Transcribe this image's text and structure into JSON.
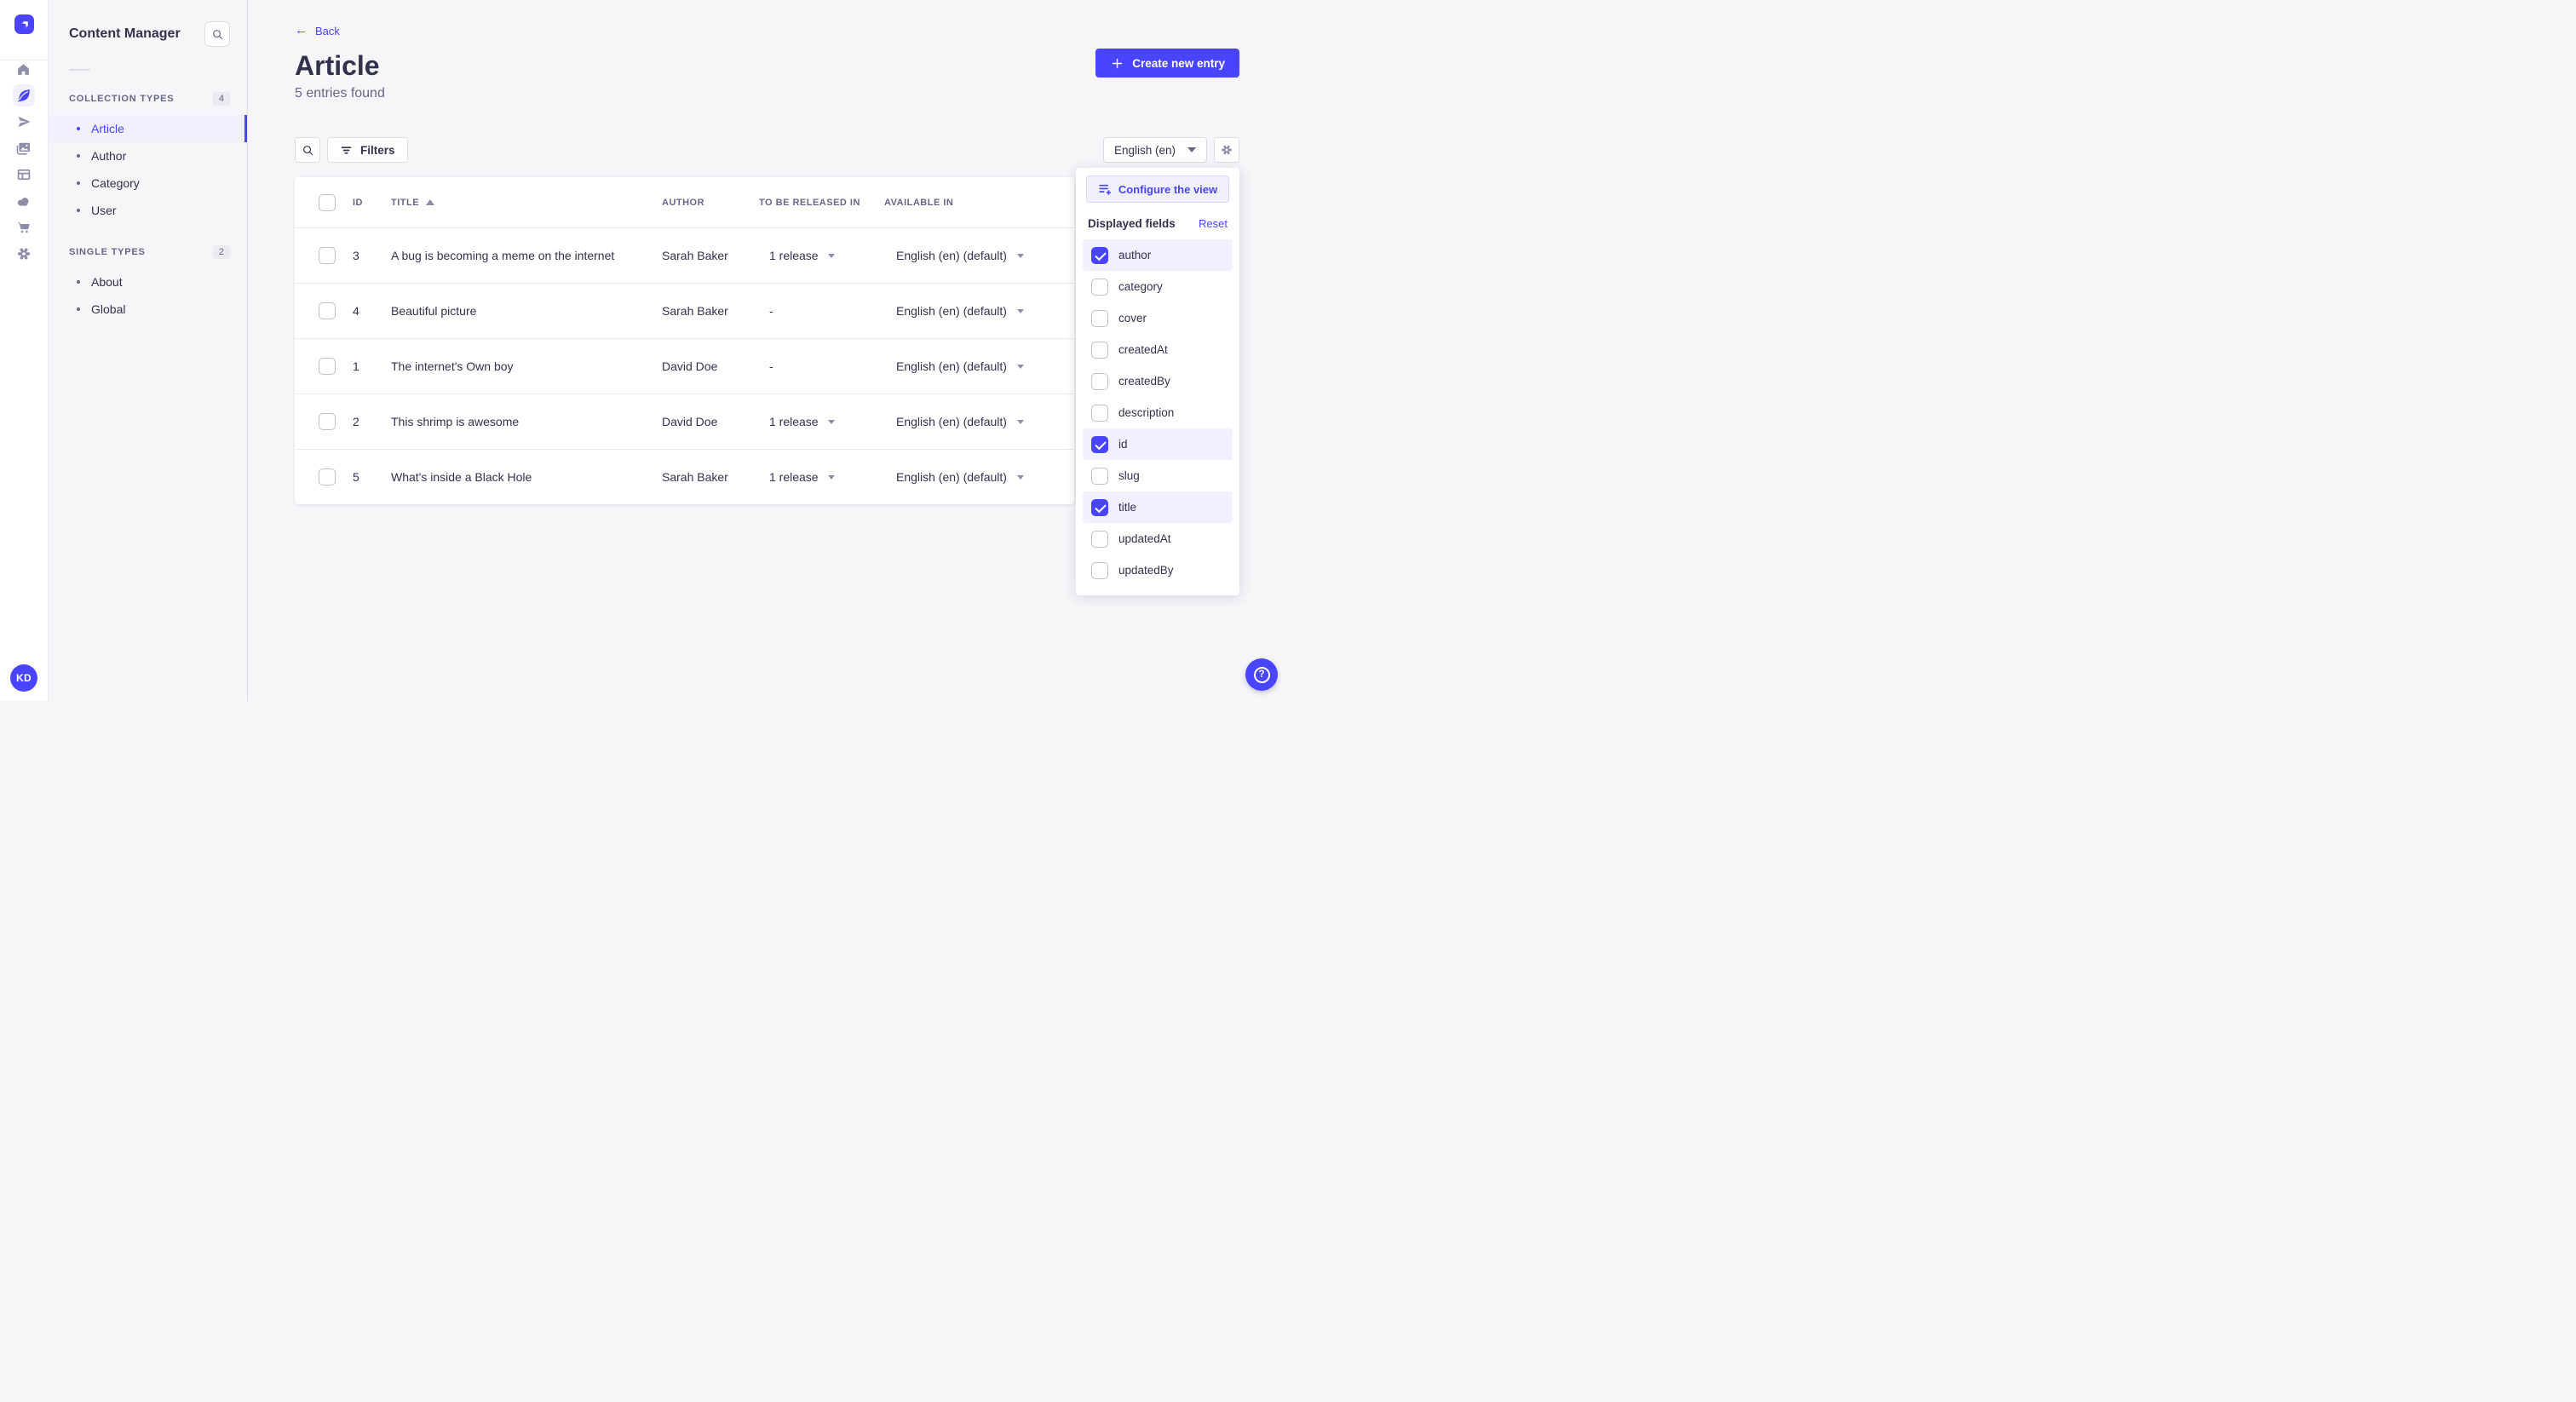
{
  "colors": {
    "primary": "#4945ff",
    "primary_light": "#f0f0ff",
    "text": "#32324d",
    "text_muted": "#666687"
  },
  "icons": {
    "back_arrow": "←",
    "help": "?"
  },
  "nav_rail": {
    "avatar_initials": "KD"
  },
  "subnav": {
    "title": "Content Manager",
    "sections": [
      {
        "label": "COLLECTION TYPES",
        "count": "4",
        "items": [
          {
            "label": "Article",
            "active": true
          },
          {
            "label": "Author",
            "active": false
          },
          {
            "label": "Category",
            "active": false
          },
          {
            "label": "User",
            "active": false
          }
        ]
      },
      {
        "label": "SINGLE TYPES",
        "count": "2",
        "items": [
          {
            "label": "About",
            "active": false
          },
          {
            "label": "Global",
            "active": false
          }
        ]
      }
    ]
  },
  "header": {
    "back_label": "Back",
    "title": "Article",
    "subtitle": "5 entries found",
    "create_button_label": "Create new entry"
  },
  "toolbar": {
    "filters_label": "Filters",
    "locale_value": "English (en)"
  },
  "table": {
    "columns": [
      "ID",
      "TITLE",
      "AUTHOR",
      "TO BE RELEASED IN",
      "AVAILABLE IN"
    ],
    "sort_column": "TITLE",
    "sort_direction": "asc",
    "rows": [
      {
        "id": "3",
        "title": "A bug is becoming a meme on the internet",
        "author": "Sarah Baker",
        "releases": "1 release",
        "available": "English (en) (default)"
      },
      {
        "id": "4",
        "title": "Beautiful picture",
        "author": "Sarah Baker",
        "releases": "-",
        "available": "English (en) (default)"
      },
      {
        "id": "1",
        "title": "The internet's Own boy",
        "author": "David Doe",
        "releases": "-",
        "available": "English (en) (default)"
      },
      {
        "id": "2",
        "title": "This shrimp is awesome",
        "author": "David Doe",
        "releases": "1 release",
        "available": "English (en) (default)"
      },
      {
        "id": "5",
        "title": "What's inside a Black Hole",
        "author": "Sarah Baker",
        "releases": "1 release",
        "available": "English (en) (default)"
      }
    ]
  },
  "popover": {
    "configure_label": "Configure the view",
    "heading": "Displayed fields",
    "reset_label": "Reset",
    "fields": [
      {
        "label": "author",
        "checked": true
      },
      {
        "label": "category",
        "checked": false
      },
      {
        "label": "cover",
        "checked": false
      },
      {
        "label": "createdAt",
        "checked": false
      },
      {
        "label": "createdBy",
        "checked": false
      },
      {
        "label": "description",
        "checked": false
      },
      {
        "label": "id",
        "checked": true
      },
      {
        "label": "slug",
        "checked": false
      },
      {
        "label": "title",
        "checked": true
      },
      {
        "label": "updatedAt",
        "checked": false
      },
      {
        "label": "updatedBy",
        "checked": false
      }
    ]
  }
}
